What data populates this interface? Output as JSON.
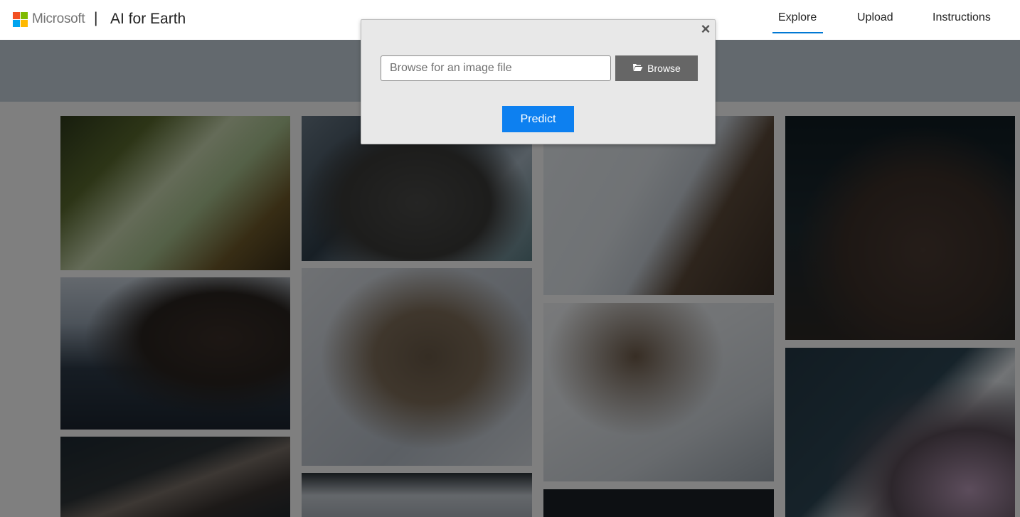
{
  "header": {
    "brand": "Microsoft",
    "divider": "|",
    "app_title": "AI for Earth",
    "nav": [
      {
        "label": "Explore",
        "active": true
      },
      {
        "label": "Upload",
        "active": false
      },
      {
        "label": "Instructions",
        "active": false
      }
    ]
  },
  "modal": {
    "close_symbol": "×",
    "file_input_placeholder": "Browse for an image file",
    "browse_label": "Browse",
    "browse_icon": "folder-open-icon",
    "predict_label": "Predict"
  },
  "gallery": {
    "images": [
      {
        "name": "satellite-image-1"
      },
      {
        "name": "satellite-image-2"
      },
      {
        "name": "satellite-image-3"
      },
      {
        "name": "satellite-image-4"
      },
      {
        "name": "satellite-image-5"
      },
      {
        "name": "satellite-image-6"
      },
      {
        "name": "satellite-image-7"
      },
      {
        "name": "satellite-image-8"
      },
      {
        "name": "satellite-image-9"
      },
      {
        "name": "satellite-image-10"
      },
      {
        "name": "satellite-image-11"
      },
      {
        "name": "satellite-image-12"
      }
    ]
  },
  "colors": {
    "accent": "#0078d4",
    "predict_button": "#0d80f0",
    "browse_button": "#666666",
    "overlay": "rgba(0,0,0,0.5)"
  }
}
